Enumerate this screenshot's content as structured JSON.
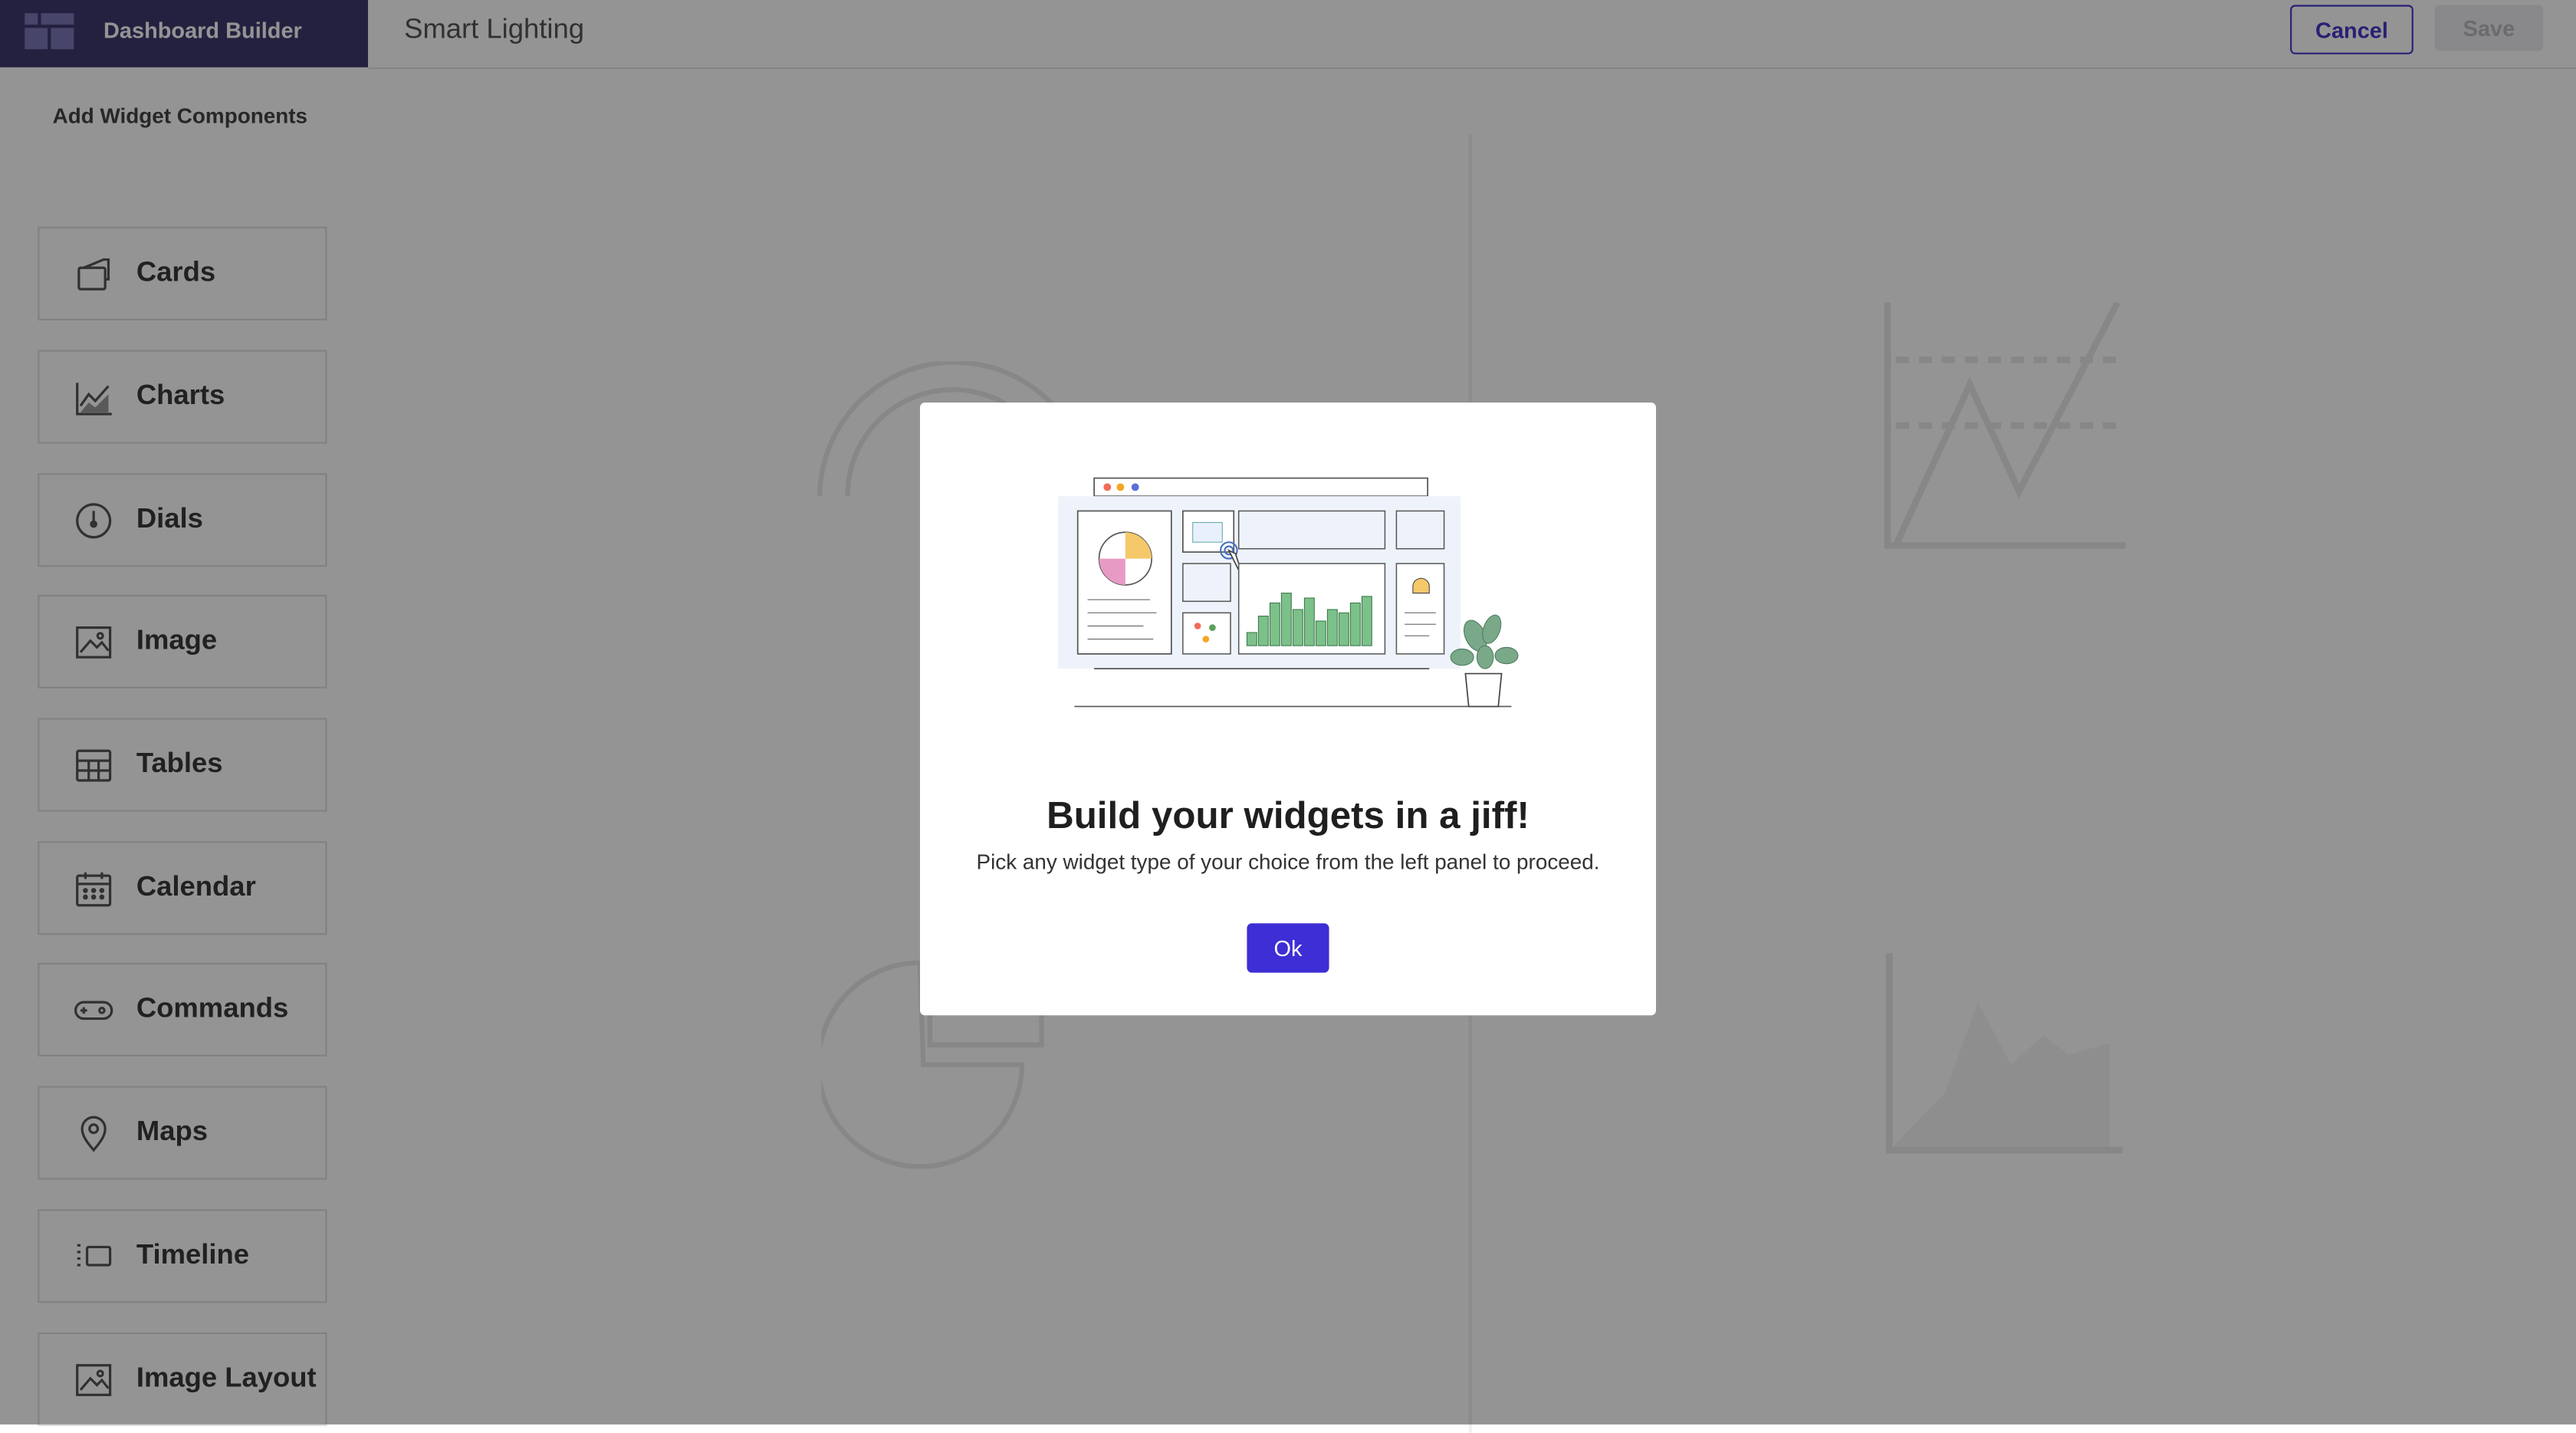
{
  "app": {
    "name": "Dashboard Builder",
    "page_title": "Smart Lighting"
  },
  "toolbar": {
    "cancel_label": "Cancel",
    "save_label": "Save"
  },
  "sidebar": {
    "heading": "Add Widget Components",
    "items": [
      {
        "label": "Cards",
        "icon": "card-icon"
      },
      {
        "label": "Charts",
        "icon": "chart-icon"
      },
      {
        "label": "Dials",
        "icon": "dial-icon"
      },
      {
        "label": "Image",
        "icon": "image-icon"
      },
      {
        "label": "Tables",
        "icon": "table-icon"
      },
      {
        "label": "Calendar",
        "icon": "calendar-icon"
      },
      {
        "label": "Commands",
        "icon": "gamepad-icon"
      },
      {
        "label": "Maps",
        "icon": "map-pin-icon"
      },
      {
        "label": "Timeline",
        "icon": "timeline-icon"
      },
      {
        "label": "Image Layout",
        "icon": "image-layout-icon"
      }
    ]
  },
  "modal": {
    "title": "Build your widgets in a jiff!",
    "text": "Pick any widget type of your choice from the left panel to proceed.",
    "ok_label": "Ok"
  },
  "colors": {
    "brand": "#3e3a6e",
    "accent": "#3e2ed6",
    "overlay": "rgba(0,0,0,0.42)"
  }
}
